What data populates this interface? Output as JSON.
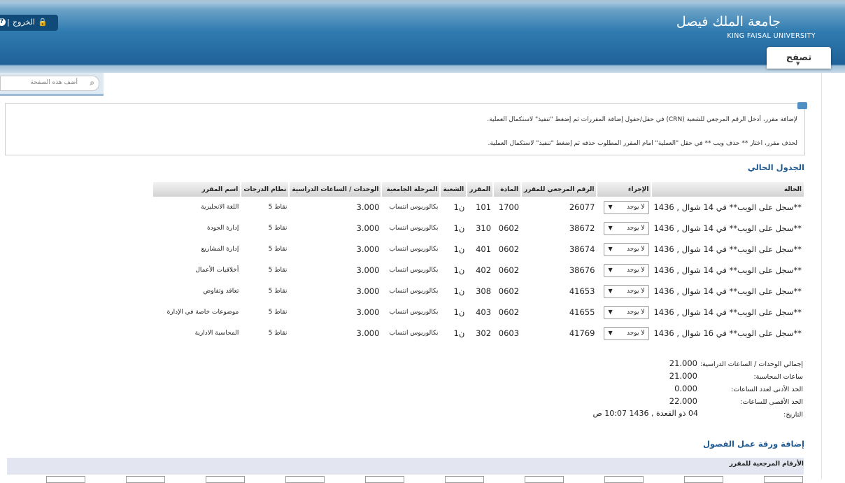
{
  "header": {
    "university_ar": "جامعة الملك فيصل",
    "university_en": "KING FAISAL UNIVERSITY",
    "browse_tab": "تصفح",
    "logout_label": "الخروج",
    "separator": "|",
    "help_glyph": "?",
    "lock_glyph": "🔒"
  },
  "search": {
    "placeholder": "أضف هذه الصفحة",
    "icon": "search-icon",
    "icon_glyph": "⌕"
  },
  "info": {
    "line1": "لإضافة مقرر، أدخل الرقم المرجعي للشعبة (CRN) في حقل/حقول إضافة المقررات ثم إضغط \"تنفيذ\" لاستكمال العملية.",
    "line2": "لحذف مقرر، اختار ** حذف ويب ** في حقل \"العملية\" امام المقرر المطلوب حذفه ثم إضغط \"تنفيذ\" لاستكمال العملية."
  },
  "schedule": {
    "title": "الجدول الحالي",
    "headers": [
      "الحالة",
      "الإجراء",
      "الرقم المرجعي للمقرر",
      "المادة",
      "المقرر",
      "الشعبة",
      "المرحلة الجامعية",
      "الوحدات / الساعات الدراسية",
      "نظام الدرجات",
      "اسم المقرر"
    ],
    "action_default": "لا يوجد",
    "rows": [
      {
        "status": "**سجل على الويب** في 14 شوال , 1436",
        "crn": "26077",
        "subject": "1700",
        "course": "101",
        "section": "ن1",
        "level": "بكالوريوس انتساب",
        "hours": "3.000",
        "grading": "نقاط 5",
        "name": "اللغة الانجليزية"
      },
      {
        "status": "**سجل على الويب** في 14 شوال , 1436",
        "crn": "38672",
        "subject": "0602",
        "course": "310",
        "section": "ن1",
        "level": "بكالوريوس انتساب",
        "hours": "3.000",
        "grading": "نقاط 5",
        "name": "إدارة الجودة"
      },
      {
        "status": "**سجل على الويب** في 14 شوال , 1436",
        "crn": "38674",
        "subject": "0602",
        "course": "401",
        "section": "ن1",
        "level": "بكالوريوس انتساب",
        "hours": "3.000",
        "grading": "نقاط 5",
        "name": "إدارة المشاريع"
      },
      {
        "status": "**سجل على الويب** في 14 شوال , 1436",
        "crn": "38676",
        "subject": "0602",
        "course": "402",
        "section": "ن1",
        "level": "بكالوريوس انتساب",
        "hours": "3.000",
        "grading": "نقاط 5",
        "name": "أخلاقيات الأعمال"
      },
      {
        "status": "**سجل على الويب** في 14 شوال , 1436",
        "crn": "41653",
        "subject": "0602",
        "course": "308",
        "section": "ن1",
        "level": "بكالوريوس انتساب",
        "hours": "3.000",
        "grading": "نقاط 5",
        "name": "تعاقد وتفاوض"
      },
      {
        "status": "**سجل على الويب** في 14 شوال , 1436",
        "crn": "41655",
        "subject": "0602",
        "course": "403",
        "section": "ن1",
        "level": "بكالوريوس انتساب",
        "hours": "3.000",
        "grading": "نقاط 5",
        "name": "موضوعات خاصة في الإدارة"
      },
      {
        "status": "**سجل على الويب** في 16 شوال , 1436",
        "crn": "41769",
        "subject": "0603",
        "course": "302",
        "section": "ن1",
        "level": "بكالوريوس انتساب",
        "hours": "3.000",
        "grading": "نقاط 5",
        "name": "المحاسبة الادارية"
      }
    ]
  },
  "summary": [
    {
      "label": "إجمالي الوحدات / الساعات الدراسية:",
      "value": "21.000"
    },
    {
      "label": "ساعات المحاسبة:",
      "value": "21.000"
    },
    {
      "label": "الحد الأدنى لعدد الساعات:",
      "value": "0.000"
    },
    {
      "label": "الحد الأقصى للساعات:",
      "value": "22.000"
    },
    {
      "label": "التاريخ:",
      "value": "04 ذو القعدة , 1436 10:07 ص"
    }
  ],
  "add_worksheet": {
    "title": "إضافة ورقة عمل الفصول",
    "crn_header": "الأرقام المرجعية للمقرر"
  }
}
